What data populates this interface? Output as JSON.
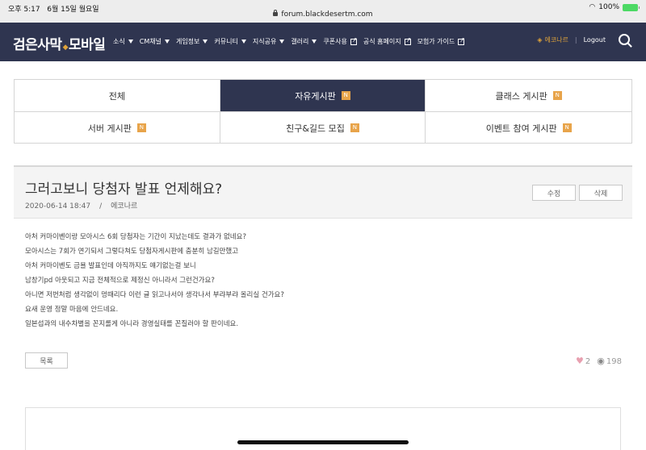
{
  "status_bar": {
    "time": "오후 5:17",
    "date": "6월 15일 월요일",
    "url": "forum.blackdesertm.com",
    "battery": "100%"
  },
  "header": {
    "logo_left": "검은사막",
    "logo_right": "모바일",
    "nav": [
      {
        "label": "소식",
        "type": "dropdown"
      },
      {
        "label": "CM채널",
        "type": "dropdown"
      },
      {
        "label": "게임정보",
        "type": "dropdown"
      },
      {
        "label": "커뮤니티",
        "type": "dropdown"
      },
      {
        "label": "지식공유",
        "type": "dropdown"
      },
      {
        "label": "갤러리",
        "type": "dropdown"
      },
      {
        "label": "쿠폰사용",
        "type": "external"
      },
      {
        "label": "공식 홈페이지",
        "type": "external"
      },
      {
        "label": "모험가 가이드",
        "type": "external"
      }
    ],
    "username": "에코나르",
    "logout": "Logout"
  },
  "boards": [
    {
      "label": "전체",
      "new": false,
      "active": false
    },
    {
      "label": "자유게시판",
      "new": true,
      "active": true
    },
    {
      "label": "클래스 게시판",
      "new": true,
      "active": false
    },
    {
      "label": "서버 게시판",
      "new": true,
      "active": false
    },
    {
      "label": "친구&길드 모집",
      "new": true,
      "active": false
    },
    {
      "label": "이벤트 참여 게시판",
      "new": true,
      "active": false
    }
  ],
  "badge_text": "N",
  "post": {
    "title": "그러고보니 당첨자 발표 언제해요?",
    "date": "2020-06-14 18:47",
    "separator": "/",
    "author": "에코나르",
    "edit_label": "수정",
    "delete_label": "삭제",
    "body_lines": [
      "아처 커마이벤이랑 모아시스 6회 당첨자는 기간이 지났는데도 결과가 없네요?",
      "모아시스는 7회가 연기되서 그렇다쳐도 당첨자게시판에 충분히 남길만했고",
      "아처 커마이벤도 금욜 발표인데 아직까지도 얘기없는걸 보니",
      "남창기pd 아웃되고 지금 전체적으로 제정신 아니라서 그런건가요?",
      "아니면 저번처럼 생각없이 멍때리다 이런 글 읽고나서야 생각나서 부랴부랴 올리실 건가요?",
      "요새 운영 정말 마음에 안드네요.",
      "일본섭과의 내수차별을 꼰지롤게 아니라 경영실태를 꼰질러야 할 판이네요."
    ],
    "list_label": "목록",
    "likes": "2",
    "views": "198"
  }
}
